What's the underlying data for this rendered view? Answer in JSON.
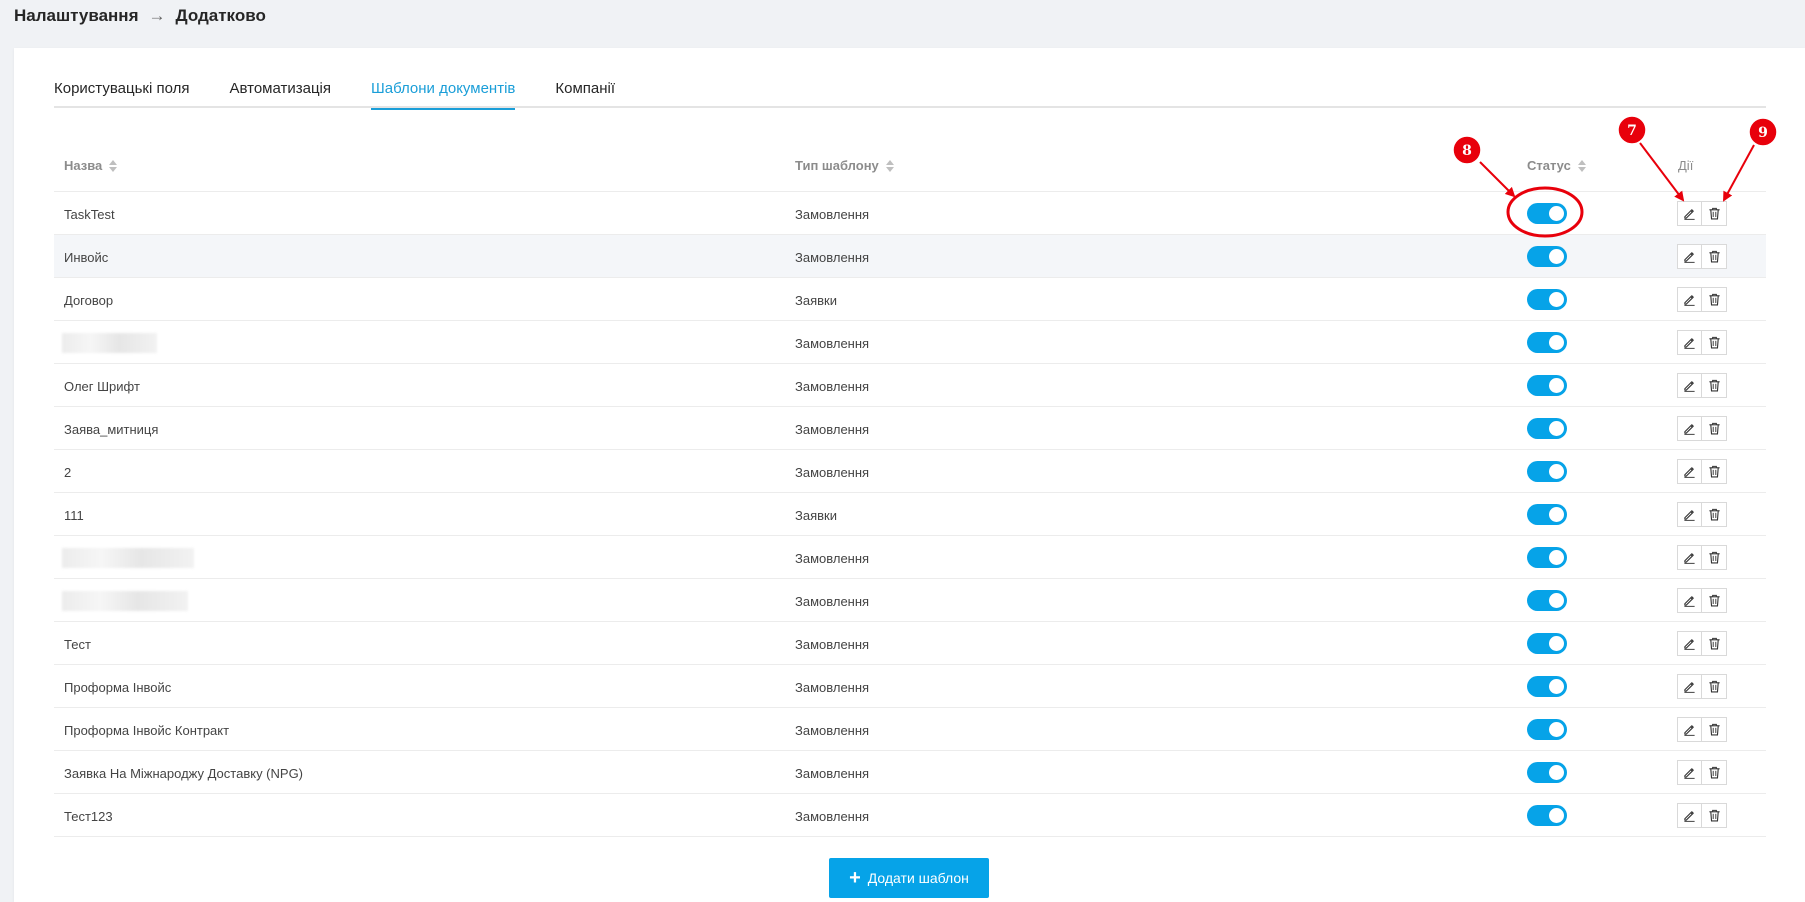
{
  "breadcrumb": {
    "root": "Налаштування",
    "current": "Додатково"
  },
  "tabs": [
    {
      "label": "Користувацькі поля",
      "active": false
    },
    {
      "label": "Автоматизація",
      "active": false
    },
    {
      "label": "Шаблони документів",
      "active": true
    },
    {
      "label": "Компанії",
      "active": false
    }
  ],
  "table": {
    "headers": {
      "name": "Назва",
      "type": "Тип шаблону",
      "status": "Статус",
      "actions": "Дії"
    },
    "rows": [
      {
        "name": "TaskTest",
        "type": "Замовлення",
        "status": true
      },
      {
        "name": "Инвойс",
        "type": "Замовлення",
        "status": true
      },
      {
        "name": "Договор",
        "type": "Заявки",
        "status": true
      },
      {
        "name": "",
        "type": "Замовлення",
        "status": true,
        "redacted": true
      },
      {
        "name": "Олег Шрифт",
        "type": "Замовлення",
        "status": true
      },
      {
        "name": "Заява_митниця",
        "type": "Замовлення",
        "status": true
      },
      {
        "name": "2",
        "type": "Замовлення",
        "status": true
      },
      {
        "name": "111",
        "type": "Заявки",
        "status": true
      },
      {
        "name": "",
        "type": "Замовлення",
        "status": true,
        "redacted": true
      },
      {
        "name": "",
        "type": "Замовлення",
        "status": true,
        "redacted": true
      },
      {
        "name": "Тест",
        "type": "Замовлення",
        "status": true
      },
      {
        "name": "Проформа Інвойс",
        "type": "Замовлення",
        "status": true
      },
      {
        "name": "Проформа Інвойс Контракт",
        "type": "Замовлення",
        "status": true
      },
      {
        "name": "Заявка На Міжнароджу Доставку (NPG)",
        "type": "Замовлення",
        "status": true
      },
      {
        "name": "Тест123",
        "type": "Замовлення",
        "status": true
      }
    ]
  },
  "add_button": {
    "label": "Додати шаблон"
  },
  "annotations": {
    "status": "8",
    "edit": "7",
    "delete": "9"
  },
  "colors": {
    "accent": "#06a3e8",
    "annotation": "#e8000b"
  },
  "icons": {
    "edit": "pencil-icon",
    "delete": "trash-icon",
    "add": "plus-icon",
    "sort": "sort-icon",
    "breadcrumb_separator": "arrow-right-icon"
  }
}
